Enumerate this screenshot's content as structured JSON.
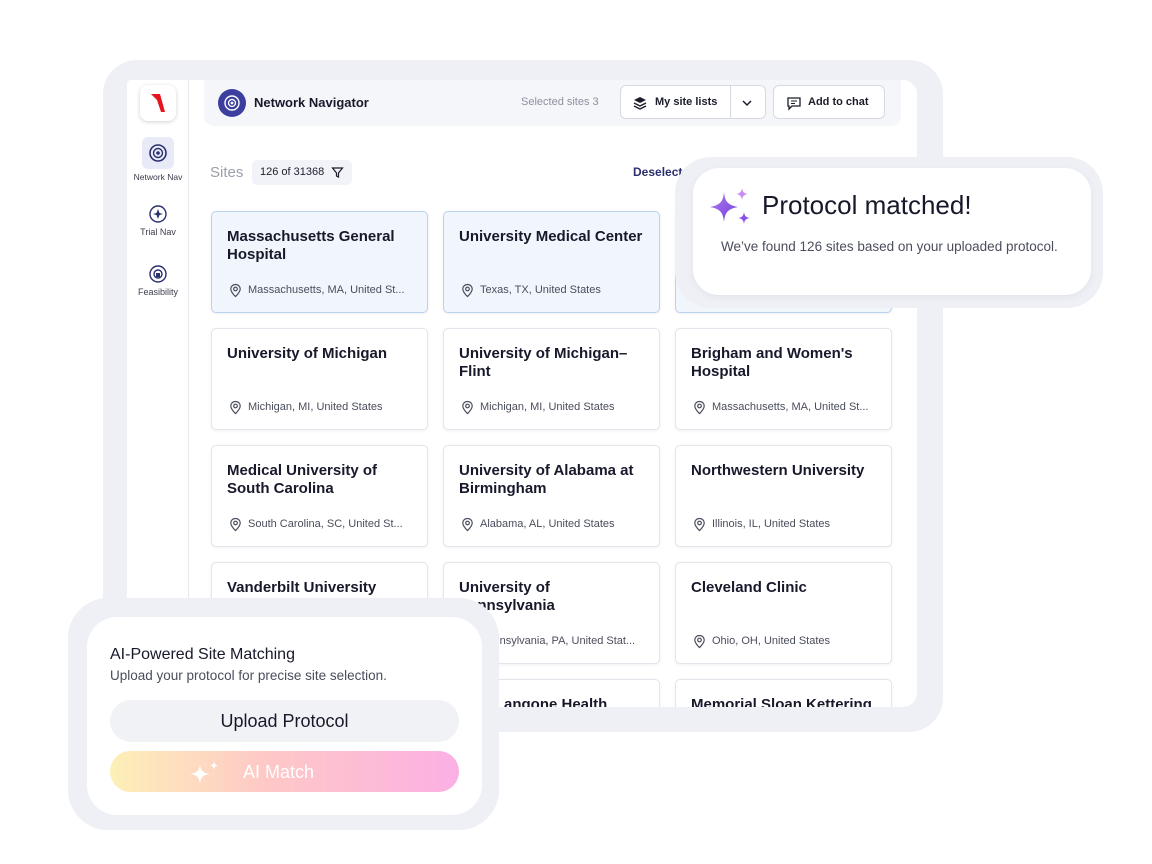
{
  "app": {
    "title": "Network Navigator",
    "selected_sites": "Selected sites 3",
    "my_site_lists": "My site lists",
    "add_to_chat": "Add to chat"
  },
  "sidebar": {
    "items": [
      {
        "label": "Network Nav",
        "icon": "network-icon",
        "active": true
      },
      {
        "label": "Trial Nav",
        "icon": "trial-icon",
        "active": false
      },
      {
        "label": "Feasibility",
        "icon": "feasibility-icon",
        "active": false
      }
    ]
  },
  "toolbar": {
    "sites_label": "Sites",
    "count": "126 of 31368",
    "deselect": "Deselect"
  },
  "cards": [
    {
      "name": "Massachusetts General Hospital",
      "location": "Massachusetts, MA, United St...",
      "selected": true
    },
    {
      "name": "University Medical Center",
      "location": "Texas, TX, United States",
      "selected": true
    },
    {
      "name": "",
      "location": "",
      "selected": true
    },
    {
      "name": "University of Michigan",
      "location": "Michigan, MI, United States",
      "selected": false
    },
    {
      "name": "University of Michigan–Flint",
      "location": "Michigan, MI, United States",
      "selected": false
    },
    {
      "name": "Brigham and Women's Hospital",
      "location": "Massachusetts, MA, United St...",
      "selected": false
    },
    {
      "name": "Medical University of South Carolina",
      "location": "South Carolina, SC, United St...",
      "selected": false
    },
    {
      "name": "University of Alabama at Birmingham",
      "location": "Alabama, AL, United States",
      "selected": false
    },
    {
      "name": "Northwestern University",
      "location": "Illinois, IL, United States",
      "selected": false
    },
    {
      "name": "Vanderbilt University",
      "location": "",
      "selected": false
    },
    {
      "name": "University of Pennsylvania",
      "location": "Pennsylvania, PA, United Stat...",
      "selected": false
    },
    {
      "name": "Cleveland Clinic",
      "location": "Ohio, OH, United States",
      "selected": false
    },
    {
      "name": "",
      "location": "",
      "selected": false
    },
    {
      "name": "NYU Langone Health",
      "location": "",
      "selected": false
    },
    {
      "name": "Memorial Sloan Kettering",
      "location": "",
      "selected": false
    }
  ],
  "popup": {
    "title": "Protocol matched!",
    "body": "We’ve found 126 sites based on your uploaded protocol."
  },
  "ai_box": {
    "title": "AI-Powered Site Matching",
    "subtitle": "Upload your protocol for precise site selection.",
    "upload_label": "Upload Protocol",
    "ai_match_label": "AI Match"
  },
  "colors": {
    "accent": "#3c3f9e",
    "logo_red": "#e5141d",
    "sparkle_purple": "#8a4fe6"
  }
}
